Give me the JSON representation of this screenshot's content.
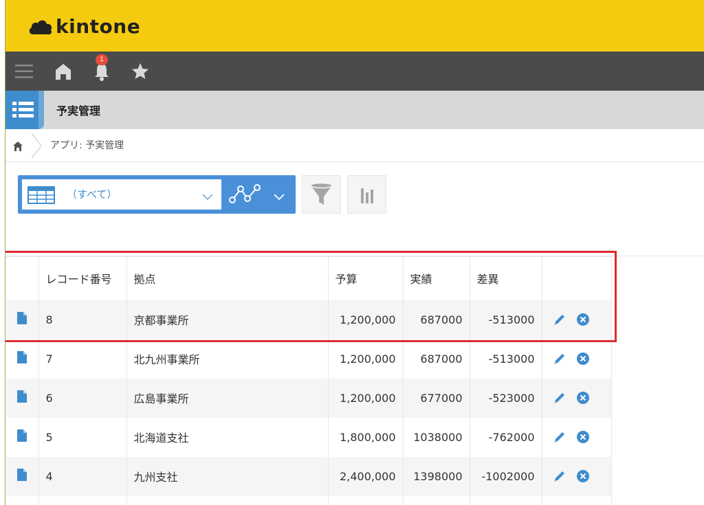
{
  "brand": {
    "logo_text": "kintone"
  },
  "nav": {
    "notification_count": "1"
  },
  "app": {
    "title": "予実管理"
  },
  "breadcrumb": {
    "text": "アプリ: 予実管理"
  },
  "view": {
    "selected": "（すべて）"
  },
  "table": {
    "headers": [
      "レコード番号",
      "拠点",
      "予算",
      "実績",
      "差異"
    ],
    "rows": [
      {
        "id": "8",
        "site": "京都事業所",
        "budget": "1,200,000",
        "actual": "687000",
        "diff": "-513000"
      },
      {
        "id": "7",
        "site": "北九州事業所",
        "budget": "1,200,000",
        "actual": "687000",
        "diff": "-513000"
      },
      {
        "id": "6",
        "site": "広島事業所",
        "budget": "1,200,000",
        "actual": "677000",
        "diff": "-523000"
      },
      {
        "id": "5",
        "site": "北海道支社",
        "budget": "1,800,000",
        "actual": "1038000",
        "diff": "-762000"
      },
      {
        "id": "4",
        "site": "九州支社",
        "budget": "2,400,000",
        "actual": "1398000",
        "diff": "-1002000"
      },
      {
        "id": "",
        "site": "",
        "budget": "",
        "actual": "",
        "diff": ""
      }
    ]
  },
  "colors": {
    "header_yellow": "#f5cb0f",
    "nav_dark": "#4b4b4b",
    "accent_blue": "#3f8ccd",
    "highlight_red": "#e0282e"
  },
  "icons": [
    "cloud-logo-icon",
    "menu-icon",
    "home-icon",
    "bell-icon",
    "star-icon",
    "list-app-icon",
    "breadcrumb-home-icon",
    "table-view-icon",
    "chevron-down-icon",
    "graph-icon",
    "filter-icon",
    "bar-chart-icon",
    "record-detail-icon",
    "edit-icon",
    "delete-icon"
  ]
}
